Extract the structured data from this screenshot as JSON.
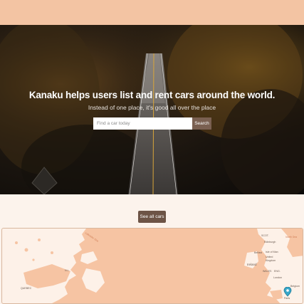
{
  "hero": {
    "title": "Kanaku helps users list and rent cars around the world.",
    "subtitle": "Instead of one place, it's good all over the place",
    "search_placeholder": "Find a car today",
    "search_button": "Search"
  },
  "actions": {
    "see_all_cars": "See all cars"
  },
  "map": {
    "labels": {
      "nl": "N.L.",
      "quebec": "QUEBEC",
      "scot": "SCOT.",
      "edinburgh": "Edinburgh",
      "belfast": "Belfast",
      "isle_of_man": "Isle of Man",
      "ireland": "Ireland",
      "united_kingdom": "United Kingdom",
      "wales": "WALES",
      "eng": "ENG.",
      "london": "London",
      "belgium": "Belgium",
      "paris": "Paris",
      "north_sea": "North Sea",
      "labrador_sea": "Labrador Sea"
    }
  }
}
